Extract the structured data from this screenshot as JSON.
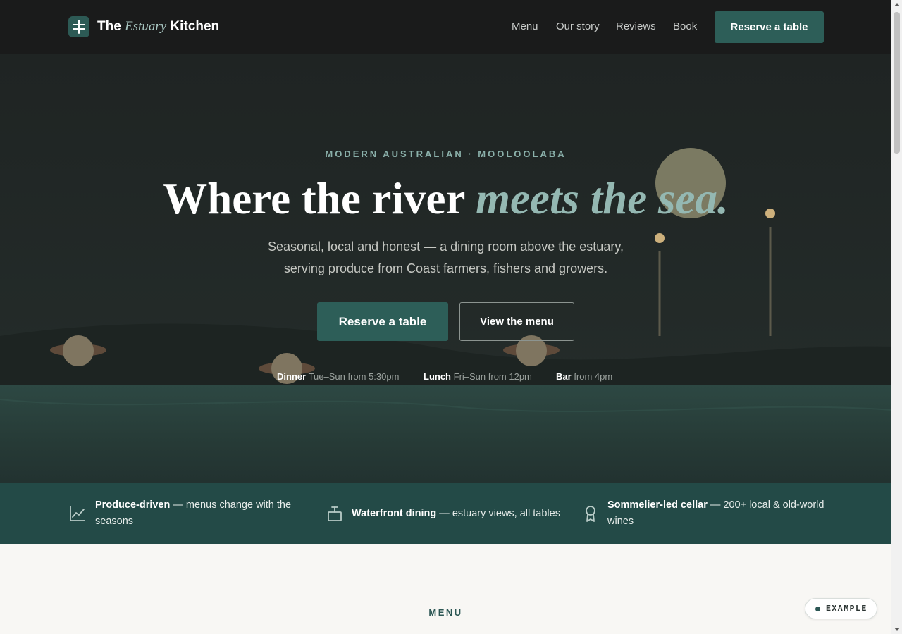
{
  "header": {
    "brand_prefix": "The",
    "brand_italic": "Estuary",
    "brand_suffix": "Kitchen",
    "logo_icon": "logo-mark-icon",
    "nav": [
      "Menu",
      "Our story",
      "Reviews",
      "Book"
    ],
    "cta": "Reserve a table"
  },
  "hero": {
    "eyebrow": "MODERN AUSTRALIAN · MOOLOOLABA",
    "headline_plain": "Where the river",
    "headline_accent": "meets the sea.",
    "subtext_line1": "Seasonal, local and honest — a dining room above the estuary,",
    "subtext_line2": "serving produce from Coast farmers, fishers and growers.",
    "primary_button": "Reserve a table",
    "secondary_button": "View the menu",
    "hours": [
      {
        "label": "Dinner",
        "value": "Tue–Sun from 5:30pm"
      },
      {
        "label": "Lunch",
        "value": "Fri–Sun from 12pm"
      },
      {
        "label": "Bar",
        "value": "from 4pm"
      }
    ]
  },
  "features": [
    {
      "icon": "chart-line-icon",
      "title": "Produce-driven",
      "text_line1": " — menus change with the",
      "text_line2": "seasons"
    },
    {
      "icon": "waterfront-icon",
      "title": "Waterfront dining",
      "text_line1": " — estuary views, all tables",
      "text_line2": ""
    },
    {
      "icon": "award-ribbon-icon",
      "title": "Sommelier-led cellar",
      "text_line1": " — 200+ local & old-world",
      "text_line2": "wines"
    }
  ],
  "menu_section": {
    "label": "MENU"
  },
  "badge": {
    "label": "EXAMPLE"
  },
  "colors": {
    "accent": "#2d5e58",
    "accent_light": "#94b8b2",
    "header_bg": "#1a1b1b",
    "feature_band": "#234a47",
    "page_bg": "#f8f7f4"
  }
}
